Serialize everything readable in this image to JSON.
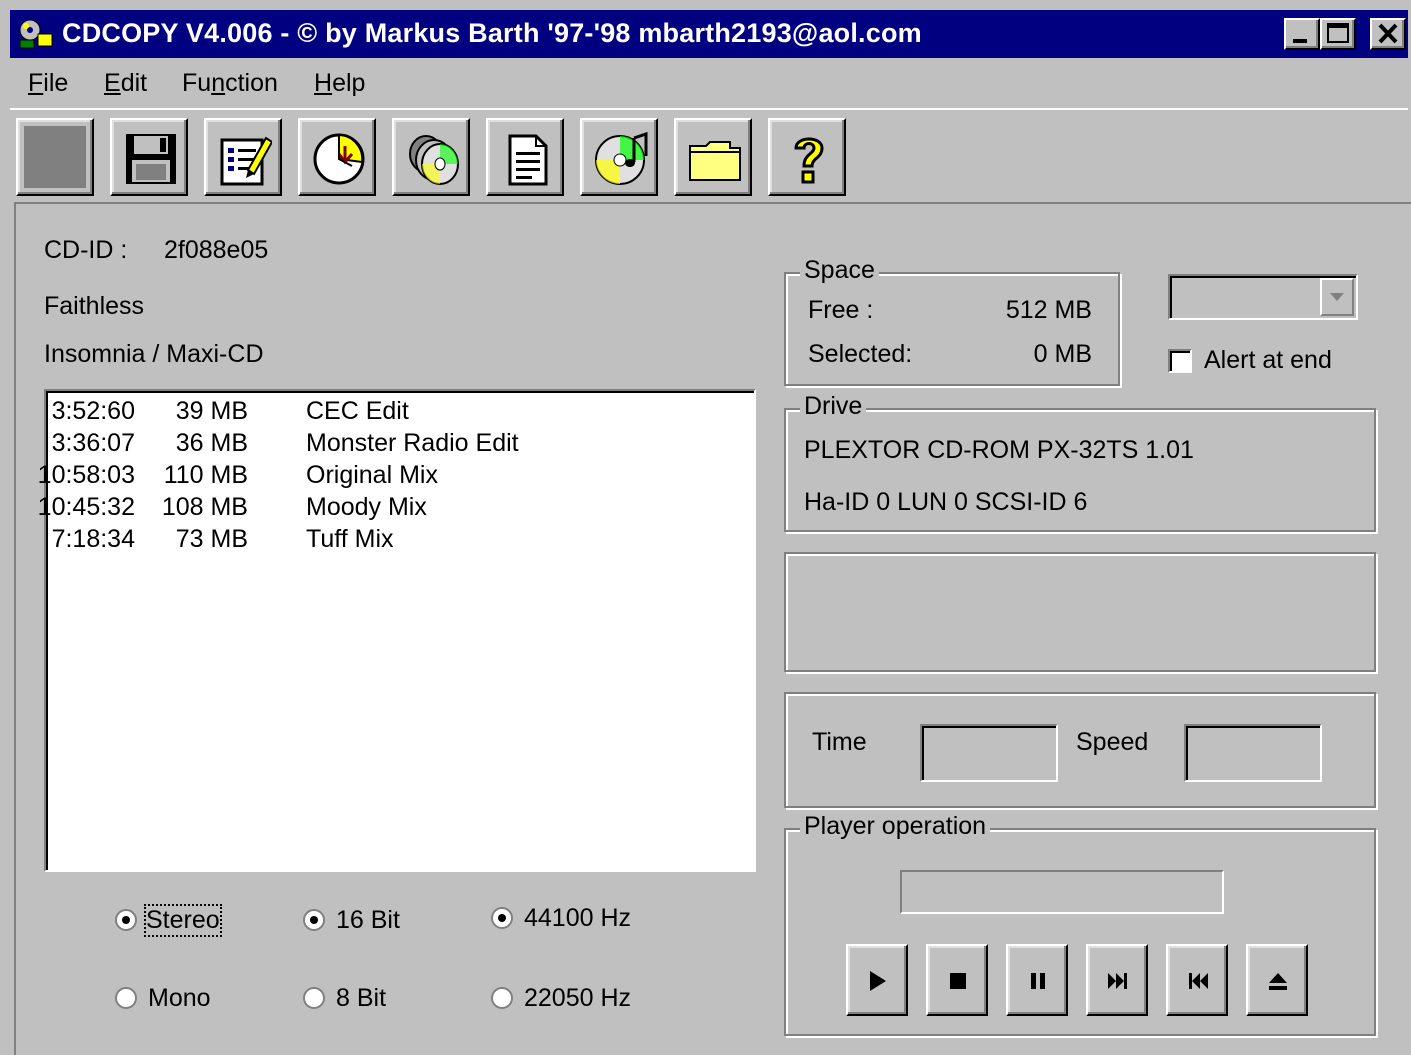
{
  "window": {
    "title": "CDCOPY  V4.006  - © by Markus Barth '97-'98 mbarth2193@aol.com",
    "controls": [
      "minimize",
      "maximize",
      "close"
    ]
  },
  "menu": {
    "file": {
      "prefix": "",
      "accel": "F",
      "rest": "ile"
    },
    "edit": {
      "prefix": "",
      "accel": "E",
      "rest": "dit"
    },
    "function": {
      "prefix": "Fu",
      "accel": "n",
      "rest": "ction"
    },
    "help": {
      "prefix": "",
      "accel": "H",
      "rest": "elp"
    }
  },
  "toolbar": {
    "icons": [
      "blank-icon",
      "floppy-save-icon",
      "notepad-edit-icon",
      "clock-icon",
      "cd-stack-icon",
      "document-icon",
      "cd-music-icon",
      "folder-icon",
      "help-question-icon"
    ]
  },
  "cd": {
    "id_label": "CD-ID :",
    "id_value": "2f088e05",
    "artist": "Faithless",
    "album": "Insomnia / Maxi-CD"
  },
  "tracks": [
    {
      "time": "3:52:60",
      "size": "39 MB",
      "name": "CEC Edit"
    },
    {
      "time": "3:36:07",
      "size": "36 MB",
      "name": "Monster Radio Edit"
    },
    {
      "time": "10:58:03",
      "size": "110 MB",
      "name": "Original Mix"
    },
    {
      "time": "10:45:32",
      "size": "108 MB",
      "name": "Moody Mix"
    },
    {
      "time": "7:18:34",
      "size": "73 MB",
      "name": "Tuff Mix"
    }
  ],
  "audio_options": {
    "channels": {
      "selected": "Stereo",
      "options": [
        "Stereo",
        "Mono"
      ]
    },
    "bits": {
      "selected": "16 Bit",
      "options": [
        "16 Bit",
        "8 Bit"
      ]
    },
    "rate": {
      "selected": "44100 Hz",
      "options": [
        "44100 Hz",
        "22050 Hz"
      ]
    }
  },
  "space": {
    "title": "Space",
    "free_label": "Free :",
    "free_value": "512 MB",
    "selected_label": "Selected:",
    "selected_value": "0 MB"
  },
  "combo": {
    "value": ""
  },
  "alert": {
    "label": "Alert at end",
    "checked": false
  },
  "drive": {
    "title": "Drive",
    "name": "PLEXTOR CD-ROM PX-32TS  1.01",
    "address": "Ha-ID 0 LUN 0 SCSI-ID 6"
  },
  "status": {
    "time_label": "Time",
    "time_value": "",
    "speed_label": "Speed",
    "speed_value": ""
  },
  "player": {
    "title": "Player operation",
    "display": "",
    "buttons": [
      "play-icon",
      "stop-icon",
      "pause-icon",
      "next-track-icon",
      "previous-track-icon",
      "eject-icon"
    ]
  }
}
